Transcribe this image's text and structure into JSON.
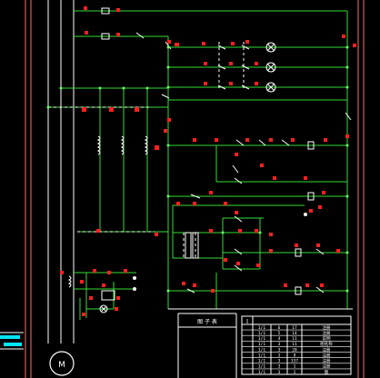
{
  "motor": {
    "symbol": "M",
    "phases": "~"
  },
  "legend_title": "图 子 表",
  "table": {
    "header": "I",
    "rows": [
      [
        "1/1",
        "6",
        "17",
        "注册"
      ],
      [
        "1/1",
        "5",
        "14",
        "注册"
      ],
      [
        "1/1",
        "4",
        "11",
        "说明"
      ],
      [
        "1/1",
        "3",
        "11",
        "图名称"
      ],
      [
        "1/1",
        "3",
        "28",
        "注册"
      ],
      [
        "1/1",
        "3",
        "9",
        "注册"
      ],
      [
        "1/1",
        "3",
        "337",
        "注册"
      ],
      [
        "1/1",
        "3",
        "1",
        "注册"
      ],
      [
        "1/1",
        "3",
        "1",
        "图"
      ]
    ]
  },
  "colors": {
    "background": "#000000",
    "wire": "#33dd33",
    "wire_bright": "#66ff66",
    "border": "#ff7070",
    "component": "#ffffff",
    "label": "#ff2020",
    "accent": "#00e5ff",
    "dashed": "#ffffff"
  }
}
